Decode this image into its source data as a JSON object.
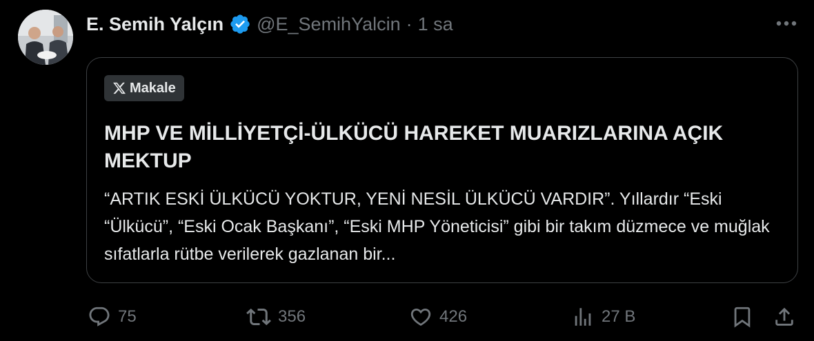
{
  "tweet": {
    "author": {
      "display_name": "E. Semih Yalçın",
      "handle": "@E_SemihYalcin",
      "separator": "·",
      "time": "1 sa",
      "verified_color": "#1d9bf0"
    },
    "article_card": {
      "badge_label": "Makale",
      "title": "MHP VE MİLLİYETÇİ-ÜLKÜCÜ HAREKET MUARIZLARINA AÇIK MEKTUP",
      "excerpt": "“ARTIK ESKİ ÜLKÜCÜ YOKTUR, YENİ NESİL ÜLKÜCÜ VARDIR”. Yıllardır “Eski “Ülkücü”, “Eski Ocak Başkanı”, “Eski MHP Yöneticisi” gibi bir takım düzmece ve muğlak sıfatlarla rütbe verilerek gazlanan bir..."
    },
    "actions": {
      "replies": "75",
      "reposts": "356",
      "likes": "426",
      "views": "27 B"
    },
    "icons": {
      "more": "more-icon",
      "reply": "reply-icon",
      "repost": "repost-icon",
      "like": "heart-icon",
      "views": "views-icon",
      "bookmark": "bookmark-icon",
      "share": "share-icon"
    },
    "colors": {
      "background": "#000000",
      "text": "#e7e9ea",
      "muted": "#71767b",
      "border": "#3e4144"
    }
  }
}
